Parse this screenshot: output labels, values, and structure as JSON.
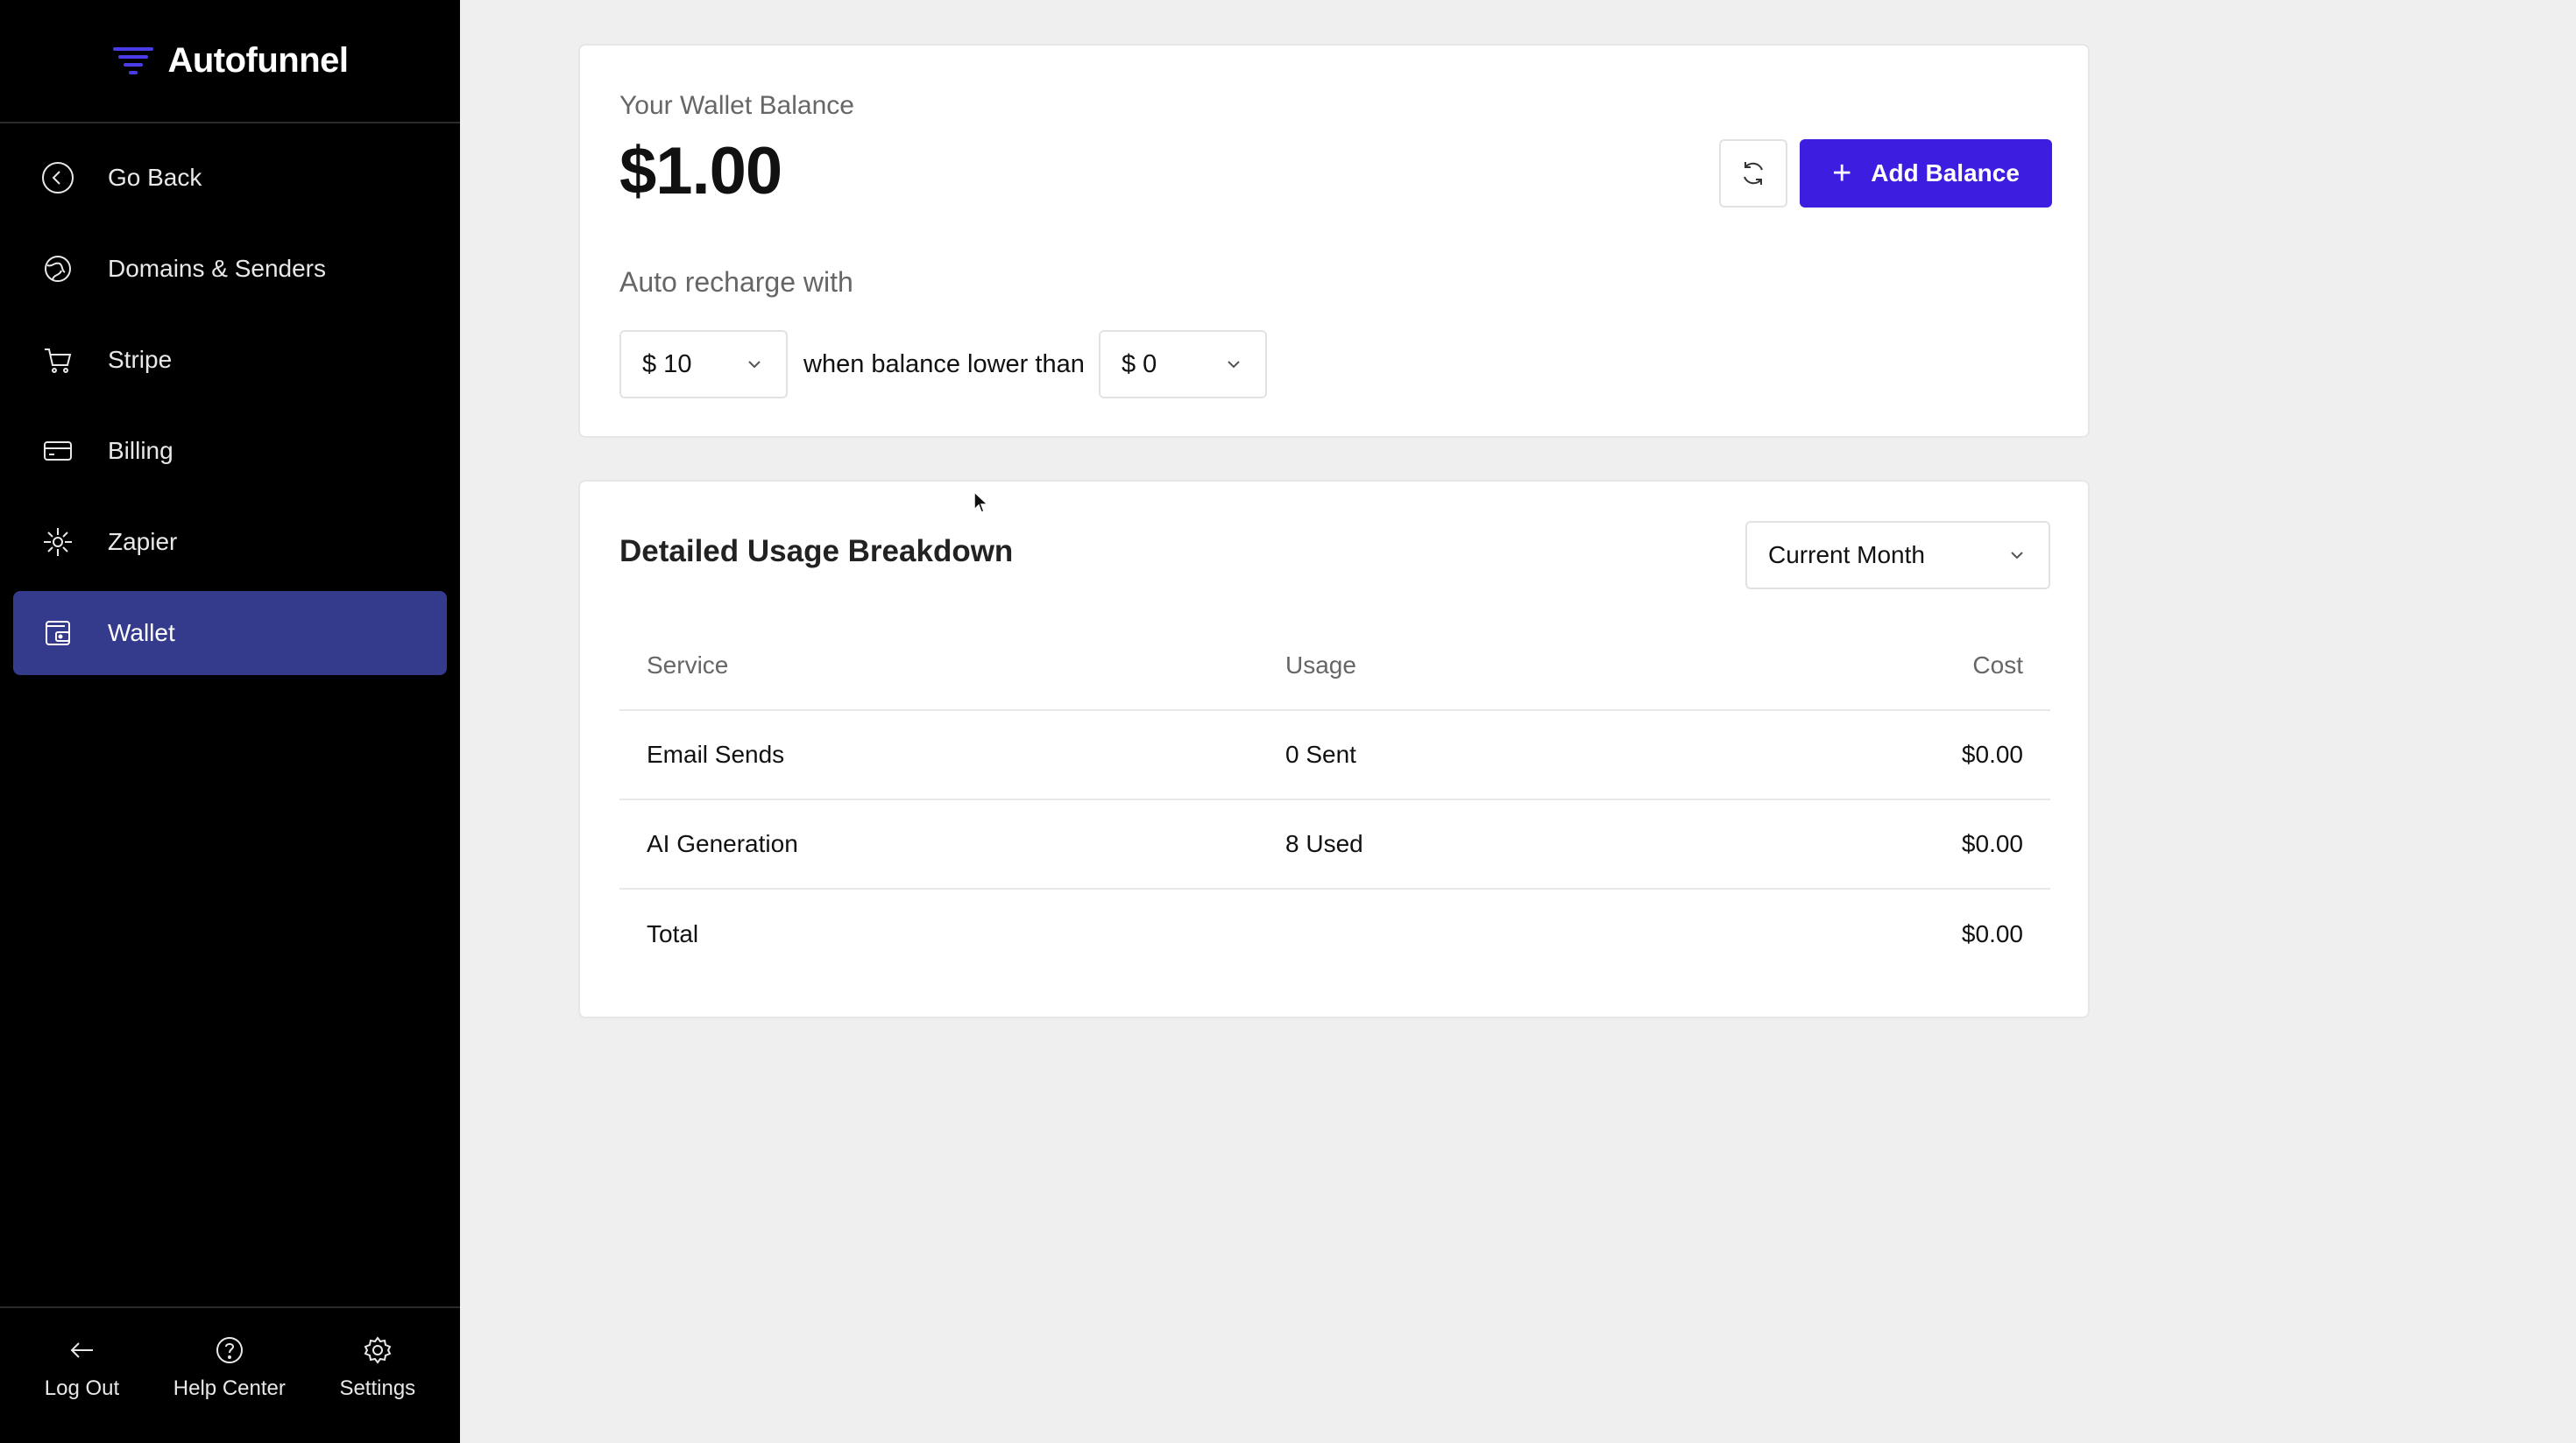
{
  "app": {
    "name": "Autofunnel",
    "brand_color": "#4a3de8"
  },
  "sidebar": {
    "active_bg": "#343a8c",
    "items": [
      {
        "label": "Go Back",
        "icon": "arrow-left-circle-icon"
      },
      {
        "label": "Domains & Senders",
        "icon": "globe-icon"
      },
      {
        "label": "Stripe",
        "icon": "cart-icon"
      },
      {
        "label": "Billing",
        "icon": "credit-card-icon"
      },
      {
        "label": "Zapier",
        "icon": "zapier-icon"
      },
      {
        "label": "Wallet",
        "icon": "wallet-icon",
        "active": true
      }
    ],
    "footer": [
      {
        "label": "Log Out",
        "icon": "arrow-left-icon"
      },
      {
        "label": "Help Center",
        "icon": "help-circle-icon"
      },
      {
        "label": "Settings",
        "icon": "gear-icon"
      }
    ]
  },
  "wallet": {
    "balance_label": "Your Wallet Balance",
    "balance_value": "$1.00",
    "refresh_icon": "refresh-icon",
    "add_button_label": "Add Balance",
    "add_button_color": "#3d1ee0",
    "recharge_label": "Auto recharge with",
    "recharge_amount": "$ 10",
    "when_text": "when balance lower than",
    "threshold_amount": "$ 0"
  },
  "usage": {
    "title": "Detailed Usage Breakdown",
    "period": "Current Month",
    "columns": [
      "Service",
      "Usage",
      "Cost"
    ],
    "rows": [
      {
        "service": "Email Sends",
        "usage": "0 Sent",
        "cost": "$0.00"
      },
      {
        "service": "AI Generation",
        "usage": "8 Used",
        "cost": "$0.00"
      },
      {
        "service": "Total",
        "usage": "",
        "cost": "$0.00"
      }
    ]
  }
}
